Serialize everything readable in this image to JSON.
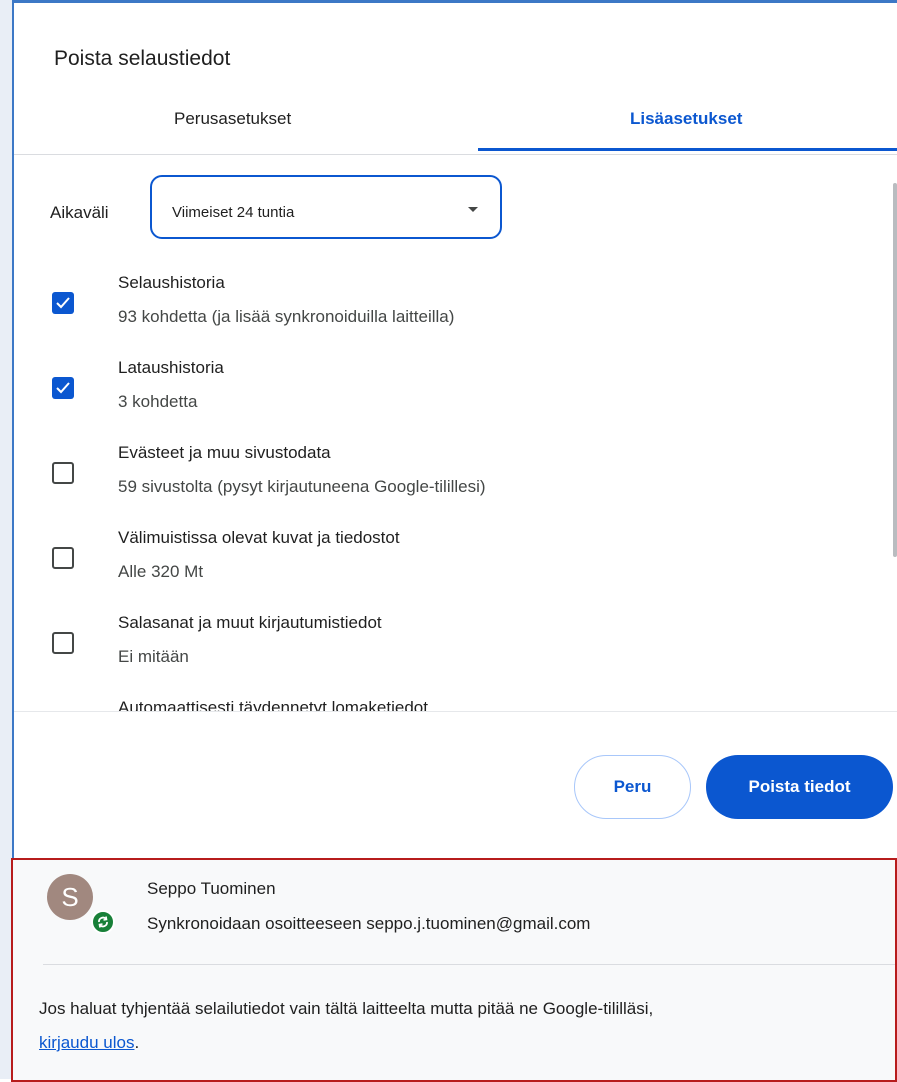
{
  "dialog": {
    "title": "Poista selaustiedot",
    "tabs": [
      {
        "label": "Perusasetukset",
        "active": false
      },
      {
        "label": "Lisäasetukset",
        "active": true
      }
    ]
  },
  "time_range": {
    "label": "Aikaväli",
    "selected": "Viimeiset 24 tuntia"
  },
  "options": [
    {
      "title": "Selaushistoria",
      "subtitle": "93 kohdetta (ja lisää synkronoiduilla laitteilla)",
      "checked": true
    },
    {
      "title": "Lataushistoria",
      "subtitle": "3 kohdetta",
      "checked": true
    },
    {
      "title": "Evästeet ja muu sivustodata",
      "subtitle": "59 sivustolta (pysyt kirjautuneena Google-tilillesi)",
      "checked": false
    },
    {
      "title": "Välimuistissa olevat kuvat ja tiedostot",
      "subtitle": "Alle 320 Mt",
      "checked": false
    },
    {
      "title": "Salasanat ja muut kirjautumistiedot",
      "subtitle": "Ei mitään",
      "checked": false
    },
    {
      "title": "Automaattisesti täydennetyt lomaketiedot",
      "subtitle": "",
      "checked": false
    }
  ],
  "buttons": {
    "cancel": "Peru",
    "delete": "Poista tiedot"
  },
  "account": {
    "avatar_letter": "S",
    "name": "Seppo Tuominen",
    "sync_text": "Synkronoidaan osoitteeseen seppo.j.tuominen@gmail.com",
    "note_text": "Jos haluat tyhjentää selailutiedot vain tältä laitteelta mutta pitää ne Google-tililläsi,",
    "signout_link": "kirjaudu ulos",
    "note_end": "."
  },
  "colors": {
    "accent": "#0b57d0",
    "highlight_border": "#b71c1c",
    "sync_green": "#188038",
    "avatar_bg": "#a1887f"
  },
  "icons": {
    "dropdown": "triangle-down-icon",
    "checkbox_checked": "check-icon",
    "sync_badge": "sync-icon"
  }
}
